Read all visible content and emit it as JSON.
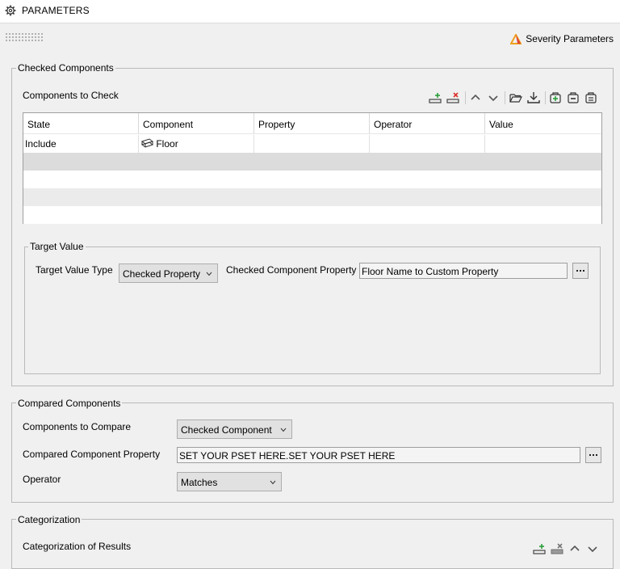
{
  "header": {
    "title": "PARAMETERS"
  },
  "severity": {
    "label": "Severity Parameters"
  },
  "checked_components": {
    "legend": "Checked Components",
    "components_label": "Components to Check",
    "columns": [
      "State",
      "Component",
      "Property",
      "Operator",
      "Value"
    ],
    "rows": [
      {
        "state": "Include",
        "component": "Floor",
        "property": "",
        "operator": "",
        "value": ""
      }
    ],
    "target_value": {
      "legend": "Target Value",
      "type_label": "Target Value Type",
      "type_value": "Checked Property",
      "property_label": "Checked Component Property",
      "property_value": "Floor Name to Custom Property"
    }
  },
  "compared_components": {
    "legend": "Compared Components",
    "compare_label": "Components to Compare",
    "compare_value": "Checked Component",
    "property_label": "Compared Component Property",
    "property_value": "SET YOUR PSET HERE.SET YOUR PSET HERE",
    "operator_label": "Operator",
    "operator_value": "Matches"
  },
  "categorization": {
    "legend": "Categorization",
    "results_label": "Categorization of Results"
  },
  "colors": {
    "accent_green": "#2a9d3a",
    "delete_red": "#d9302c",
    "severity_orange": "#f0a020"
  }
}
